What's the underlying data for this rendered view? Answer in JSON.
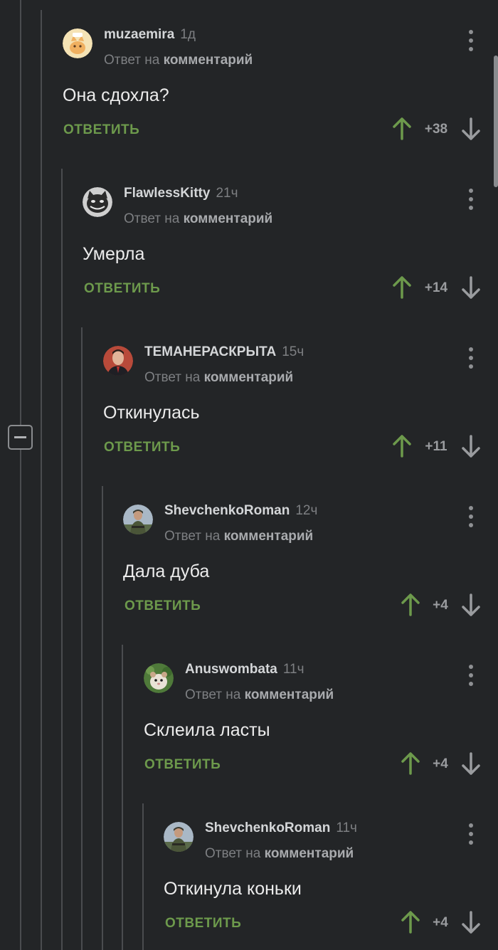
{
  "comments": [
    {
      "author": "muzaemira",
      "time": "1д",
      "reply_prefix": "Ответ на",
      "reply_link": "комментарий",
      "text": "Она сдохла?",
      "reply_label": "ОТВЕТИТЬ",
      "score": "+38",
      "avatar": "cat-avatar"
    },
    {
      "author": "FlawlessKitty",
      "time": "21ч",
      "reply_prefix": "Ответ на",
      "reply_link": "комментарий",
      "text": "Умерла",
      "reply_label": "ОТВЕТИТЬ",
      "score": "+14",
      "avatar": "grinning-cat-avatar"
    },
    {
      "author": "ТЕМАНЕРАСКРЫТА",
      "time": "15ч",
      "reply_prefix": "Ответ на",
      "reply_link": "комментарий",
      "text": "Откинулась",
      "reply_label": "ОТВЕТИТЬ",
      "score": "+11",
      "avatar": "man-avatar"
    },
    {
      "author": "ShevchenkoRoman",
      "time": "12ч",
      "reply_prefix": "Ответ на",
      "reply_link": "комментарий",
      "text": "Дала дуба",
      "reply_label": "ОТВЕТИТЬ",
      "score": "+4",
      "avatar": "soldier-avatar"
    },
    {
      "author": "Anuswombata",
      "time": "11ч",
      "reply_prefix": "Ответ на",
      "reply_link": "комментарий",
      "text": "Склеила ласты",
      "reply_label": "ОТВЕТИТЬ",
      "score": "+4",
      "avatar": "hamster-avatar"
    },
    {
      "author": "ShevchenkoRoman",
      "time": "11ч",
      "reply_prefix": "Ответ на",
      "reply_link": "комментарий",
      "text": "Откинула коньки",
      "reply_label": "ОТВЕТИТЬ",
      "score": "+4",
      "avatar": "soldier-avatar"
    }
  ],
  "colors": {
    "background": "#232527",
    "reply_button": "#6d9a4c",
    "upvote_arrow": "#6d9a4c",
    "downvote_arrow": "#9a9c9f",
    "thread_line": "#4a4c4f"
  }
}
